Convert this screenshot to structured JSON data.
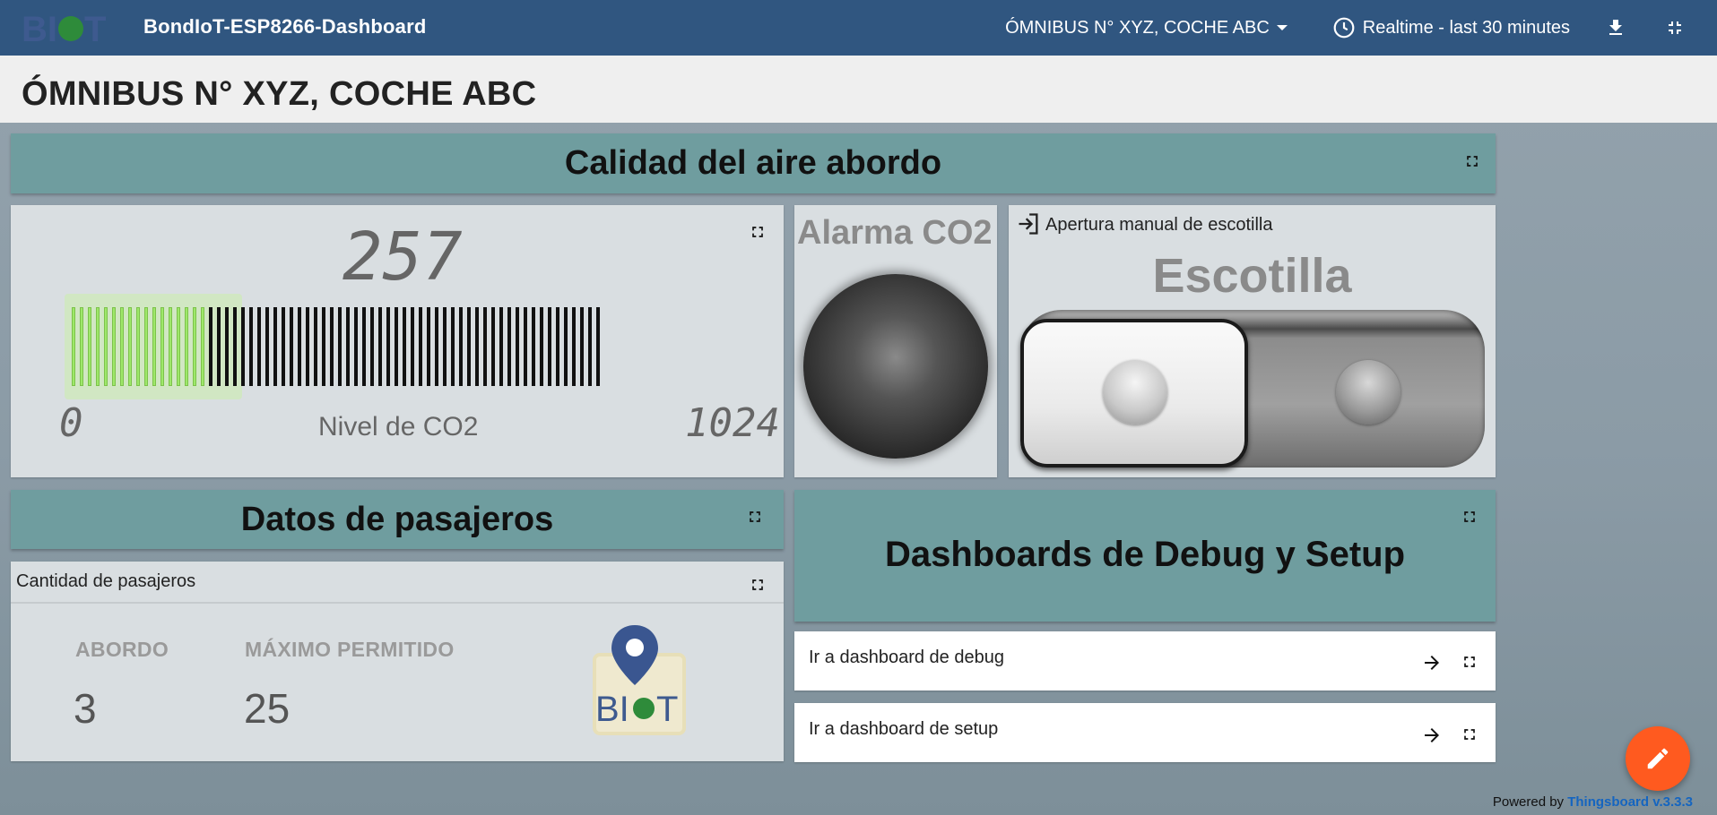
{
  "app": {
    "title": "BondIoT-ESP8266-Dashboard",
    "state_selector": "ÓMNIBUS N° XYZ, COCHE ABC",
    "timewindow": "Realtime - last 30 minutes",
    "logo_text": "BIoT"
  },
  "page": {
    "title": "ÓMNIBUS N° XYZ, COCHE ABC"
  },
  "air_quality": {
    "header": "Calidad del aire abordo",
    "co2": {
      "value": "257",
      "min": "0",
      "max": "1024",
      "label": "Nivel de CO2",
      "fill_fraction": 0.251,
      "active_color": "#9ee86a"
    },
    "alarm": {
      "title": "Alarma CO2",
      "state": "off"
    },
    "hatch": {
      "widget_title": "Apertura manual de escotilla",
      "label": "Escotilla",
      "state": "off"
    }
  },
  "passengers": {
    "header": "Datos de pasajeros",
    "card_title": "Cantidad de pasajeros",
    "aboard_label": "ABORDO",
    "aboard_value": "3",
    "max_label": "MÁXIMO PERMITIDO",
    "max_value": "25",
    "logo_text": "BIoT"
  },
  "debug": {
    "header": "Dashboards de Debug y Setup",
    "links": [
      {
        "label": "Ir a dashboard de debug"
      },
      {
        "label": "Ir a dashboard de setup"
      }
    ]
  },
  "footer": {
    "powered_by": "Powered by",
    "brand": "Thingsboard v.3.3.3"
  },
  "colors": {
    "topbar": "#305680",
    "teal_header": "#6f9d9f",
    "fab": "#ff5a1f"
  }
}
